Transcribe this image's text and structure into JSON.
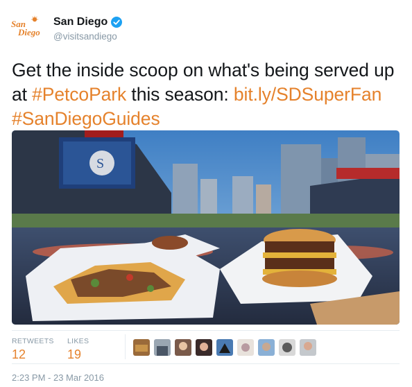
{
  "author": {
    "display_name": "San Diego",
    "handle": "@visitsandiego",
    "verified": true,
    "logo_text": "San Diego"
  },
  "tweet": {
    "segments": [
      {
        "text": "Get the inside scoop on what's being served up at ",
        "type": "text"
      },
      {
        "text": "#PetcoPark",
        "type": "hashtag"
      },
      {
        "text": " this season: ",
        "type": "text"
      },
      {
        "text": "bit.ly/SDSuperFan",
        "type": "link"
      },
      {
        "text": " ",
        "type": "text"
      },
      {
        "text": "#SanDiegoGuides",
        "type": "hashtag"
      }
    ]
  },
  "media": {
    "icon": "photo-stadium-food"
  },
  "stats": {
    "retweets_label": "RETWEETS",
    "retweets_count": "12",
    "likes_label": "LIKES",
    "likes_count": "19"
  },
  "likers": [
    {
      "icon": "liker-avatar"
    },
    {
      "icon": "liker-avatar"
    },
    {
      "icon": "liker-avatar"
    },
    {
      "icon": "liker-avatar"
    },
    {
      "icon": "liker-avatar"
    },
    {
      "icon": "liker-avatar"
    },
    {
      "icon": "liker-avatar"
    },
    {
      "icon": "liker-avatar"
    },
    {
      "icon": "liker-avatar"
    }
  ],
  "timestamp": "2:23 PM - 23 Mar 2016",
  "colors": {
    "accent": "#e5822c",
    "verified": "#1da1f2",
    "muted": "#8899a6"
  }
}
